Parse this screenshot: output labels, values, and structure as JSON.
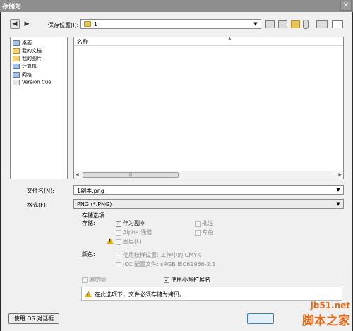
{
  "window": {
    "title": "存储为"
  },
  "toolbar": {
    "save_location_label": "保存位置(I):",
    "location_value": "1"
  },
  "places": [
    {
      "label": "桌面"
    },
    {
      "label": "我的文档"
    },
    {
      "label": "我的图片"
    },
    {
      "label": "计算机"
    },
    {
      "label": "网络"
    },
    {
      "label": "Version Cue"
    }
  ],
  "filelist": {
    "column_name": "名称"
  },
  "filename": {
    "label": "文件名(N):",
    "value": "1副本.png"
  },
  "format": {
    "label": "格式(F):",
    "value": "PNG (*.PNG)"
  },
  "options": {
    "group_title": "存储选项",
    "store_label": "存储:",
    "as_copy": "作为副本",
    "annotations": "批注",
    "alpha": "Alpha 通道",
    "spot": "专色",
    "layers": "图层(L)",
    "color_label": "颜色:",
    "proof": "使用校样设置: 工作中的 CMYK",
    "icc": "ICC 配置文件: sRGB IEC61966-2.1",
    "thumbnail": "缩览图",
    "lowercase_ext": "使用小写扩展名",
    "notice": "在此选项下，文件必须存储为拷贝。"
  },
  "buttons": {
    "os_dialog": "使用 OS 对话框"
  },
  "watermark": {
    "line1": "jb51.net",
    "line2": "脚本之家"
  },
  "colors": {
    "titlebar": "#8e8e8e",
    "warning": "#e0b000",
    "watermark": "#e06a1a"
  }
}
